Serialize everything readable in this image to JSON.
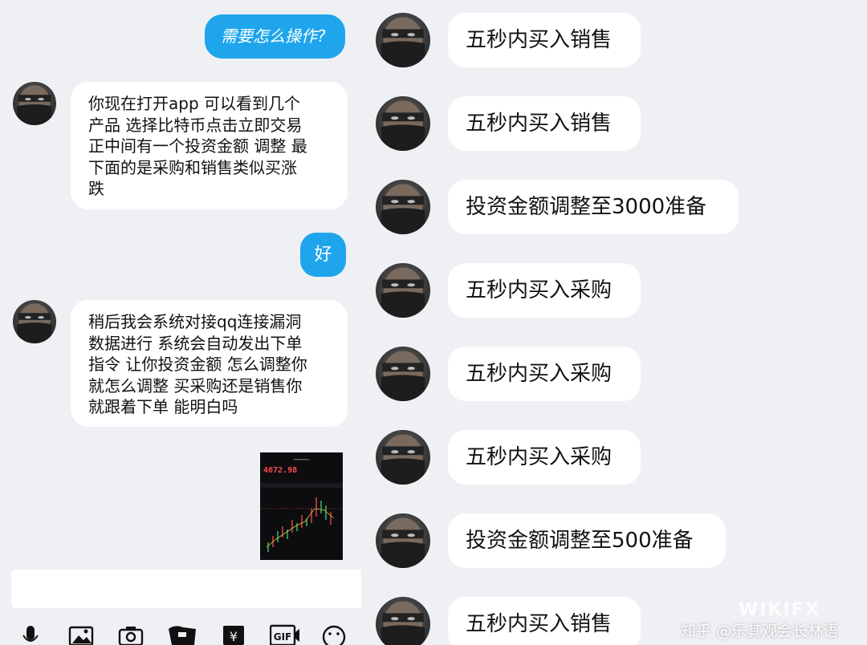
{
  "left_chat": {
    "messages": [
      {
        "sender": "self",
        "text": "需要怎么操作?"
      },
      {
        "sender": "other",
        "text": "你现在打开app 可以看到几个\n产品 选择比特币点击立即交易\n正中间有一个投资金额 调整 最\n下面的是采购和销售类似买涨\n跌"
      },
      {
        "sender": "self",
        "text": "好"
      },
      {
        "sender": "other",
        "text": "稍后我会系统对接qq连接漏洞\n数据进行 系统会自动发出下单\n指令 让你投资金额 怎么调整你\n就怎么调整 买采购还是销售你\n就跟着下单 能明白吗"
      }
    ],
    "image_message": {
      "price": "4672.98"
    },
    "toolbar": [
      "microphone-icon",
      "image-icon",
      "camera-icon",
      "red-packet-icon",
      "transfer-icon",
      "gif-icon",
      "emoji-icon"
    ]
  },
  "right_chat": {
    "messages": [
      "五秒内买入销售",
      "五秒内买入销售",
      "投资金额调整至3000准备",
      "五秒内买入采购",
      "五秒内买入采购",
      "五秒内买入采购",
      "投资金额调整至500准备",
      "五秒内买入销售"
    ]
  },
  "watermark": {
    "text": "知乎 @乐其观会长林语",
    "logo": "WIKIFX"
  },
  "colors": {
    "background": "#eef0f4",
    "self_bubble": "#1ea5ec",
    "other_bubble": "#ffffff"
  }
}
